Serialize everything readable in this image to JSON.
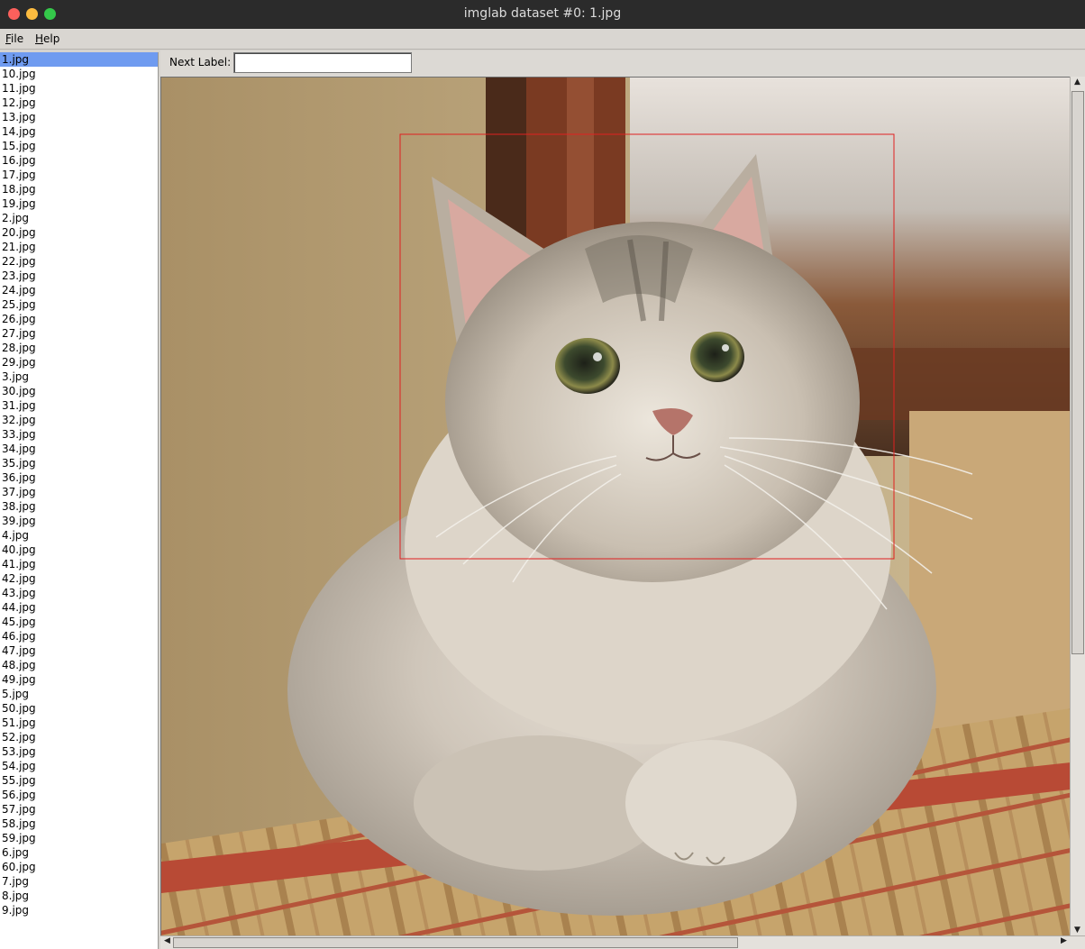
{
  "window": {
    "title": "imglab dataset #0: 1.jpg"
  },
  "menu": {
    "file_label": "File",
    "help_label": "Help"
  },
  "toolbar": {
    "next_label": "Next Label:",
    "next_value": ""
  },
  "files": {
    "selected_index": 0,
    "items": [
      "1.jpg",
      "10.jpg",
      "11.jpg",
      "12.jpg",
      "13.jpg",
      "14.jpg",
      "15.jpg",
      "16.jpg",
      "17.jpg",
      "18.jpg",
      "19.jpg",
      "2.jpg",
      "20.jpg",
      "21.jpg",
      "22.jpg",
      "23.jpg",
      "24.jpg",
      "25.jpg",
      "26.jpg",
      "27.jpg",
      "28.jpg",
      "29.jpg",
      "3.jpg",
      "30.jpg",
      "31.jpg",
      "32.jpg",
      "33.jpg",
      "34.jpg",
      "35.jpg",
      "36.jpg",
      "37.jpg",
      "38.jpg",
      "39.jpg",
      "4.jpg",
      "40.jpg",
      "41.jpg",
      "42.jpg",
      "43.jpg",
      "44.jpg",
      "45.jpg",
      "46.jpg",
      "47.jpg",
      "48.jpg",
      "49.jpg",
      "5.jpg",
      "50.jpg",
      "51.jpg",
      "52.jpg",
      "53.jpg",
      "54.jpg",
      "55.jpg",
      "56.jpg",
      "57.jpg",
      "58.jpg",
      "59.jpg",
      "6.jpg",
      "60.jpg",
      "7.jpg",
      "8.jpg",
      "9.jpg"
    ]
  },
  "image": {
    "subject": "kitten on striped sofa",
    "box_color": "#e02020"
  },
  "colors": {
    "selection": "#6f9bf0",
    "titlebar": "#2b2b2b"
  }
}
